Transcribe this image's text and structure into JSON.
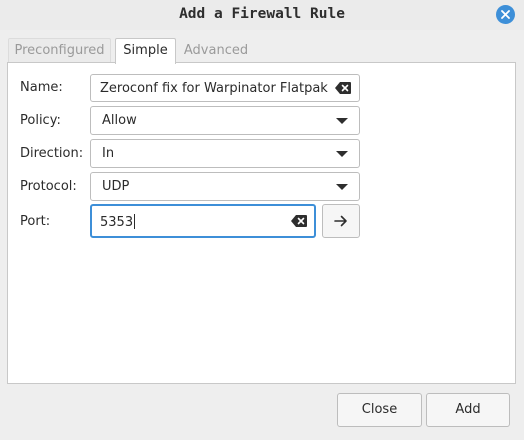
{
  "window": {
    "title": "Add a Firewall Rule",
    "close_icon": "close-icon",
    "accent": "#3d8fd8"
  },
  "tabs": [
    {
      "label": "Preconfigured",
      "active": false
    },
    {
      "label": "Simple",
      "active": true
    },
    {
      "label": "Advanced",
      "active": false
    }
  ],
  "form": {
    "name": {
      "label": "Name:",
      "value": "Zeroconf fix for Warpinator Flatpak"
    },
    "policy": {
      "label": "Policy:",
      "value": "Allow"
    },
    "direction": {
      "label": "Direction:",
      "value": "In"
    },
    "protocol": {
      "label": "Protocol:",
      "value": "UDP"
    },
    "port": {
      "label": "Port:",
      "value": "5353"
    }
  },
  "buttons": {
    "close": "Close",
    "add": "Add"
  }
}
